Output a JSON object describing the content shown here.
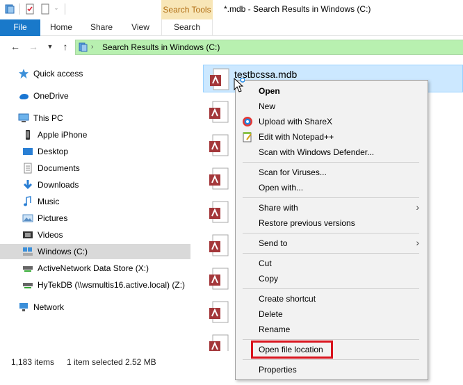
{
  "window": {
    "title": "*.mdb - Search Results in Windows (C:)",
    "context_tab": "Search Tools"
  },
  "ribbon": {
    "tabs": [
      "File",
      "Home",
      "Share",
      "View",
      "Search"
    ]
  },
  "address": {
    "path": "Search Results in Windows (C:)"
  },
  "navpane": {
    "items": [
      {
        "label": "Quick access",
        "icon": "star-icon"
      },
      {
        "label": "OneDrive",
        "icon": "cloud-icon"
      },
      {
        "label": "This PC",
        "icon": "computer-icon"
      },
      {
        "label": "Apple iPhone",
        "icon": "phone-icon"
      },
      {
        "label": "Desktop",
        "icon": "desktop-icon"
      },
      {
        "label": "Documents",
        "icon": "documents-icon"
      },
      {
        "label": "Downloads",
        "icon": "download-icon"
      },
      {
        "label": "Music",
        "icon": "music-icon"
      },
      {
        "label": "Pictures",
        "icon": "pictures-icon"
      },
      {
        "label": "Videos",
        "icon": "videos-icon"
      },
      {
        "label": "Windows (C:)",
        "icon": "drive-icon"
      },
      {
        "label": "ActiveNetwork Data Store (X:)",
        "icon": "network-drive-icon"
      },
      {
        "label": "HyTekDB (\\\\wsmultis16.active.local) (Z:)",
        "icon": "network-drive-icon"
      },
      {
        "label": "Network",
        "icon": "network-icon"
      }
    ],
    "selected": "Windows (C:)"
  },
  "files": {
    "selected_name": "testbcssa.mdb"
  },
  "context_menu": {
    "items": [
      "Open",
      "New",
      "Upload with ShareX",
      "Edit with Notepad++",
      "Scan with Windows Defender...",
      "Scan for Viruses...",
      "Open with...",
      "Share with",
      "Restore previous versions",
      "Send to",
      "Cut",
      "Copy",
      "Create shortcut",
      "Delete",
      "Rename",
      "Open file location",
      "Properties"
    ],
    "highlight_color": "#d9141e"
  },
  "status": {
    "item_count": "1,183 items",
    "selection": "1 item selected",
    "size": "2.52 MB"
  }
}
